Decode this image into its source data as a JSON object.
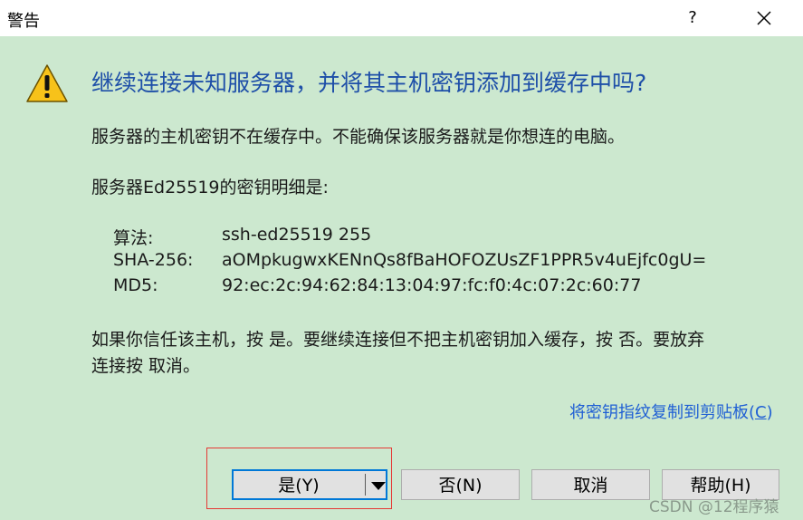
{
  "window": {
    "title": "警告",
    "help_label": "?"
  },
  "dialog": {
    "heading": "继续连接未知服务器，并将其主机密钥添加到缓存中吗?",
    "para1": "服务器的主机密钥不在缓存中。不能确保该服务器就是你想连的电脑。",
    "para2": "服务器Ed25519的密钥明细是:",
    "key_rows": [
      {
        "label": "算法:",
        "value": "ssh-ed25519 255"
      },
      {
        "label": "SHA-256:",
        "value": "aOMpkugwxKENnQs8fBaHOFOZUsZF1PPR5v4uEjfc0gU="
      },
      {
        "label": "MD5:",
        "value": "92:ec:2c:94:62:84:13:04:97:fc:f0:4c:07:2c:60:77"
      }
    ],
    "para3_line1": "如果你信任该主机，按 是。要继续连接但不把主机密钥加入缓存，按 否。要放弃",
    "para3_line2": "连接按 取消。",
    "copy_link_text": "将密钥指纹复制到剪贴板(",
    "copy_link_key": "C",
    "copy_link_end": ")"
  },
  "buttons": {
    "yes": "是(Y)",
    "no": "否(N)",
    "cancel": "取消",
    "help": "帮助(H)"
  },
  "watermark": "CSDN @12程序猿",
  "colors": {
    "background": "#cce8cf",
    "heading": "#1e4fa8",
    "link": "#1f5fd4",
    "highlight_box": "#e53935"
  }
}
